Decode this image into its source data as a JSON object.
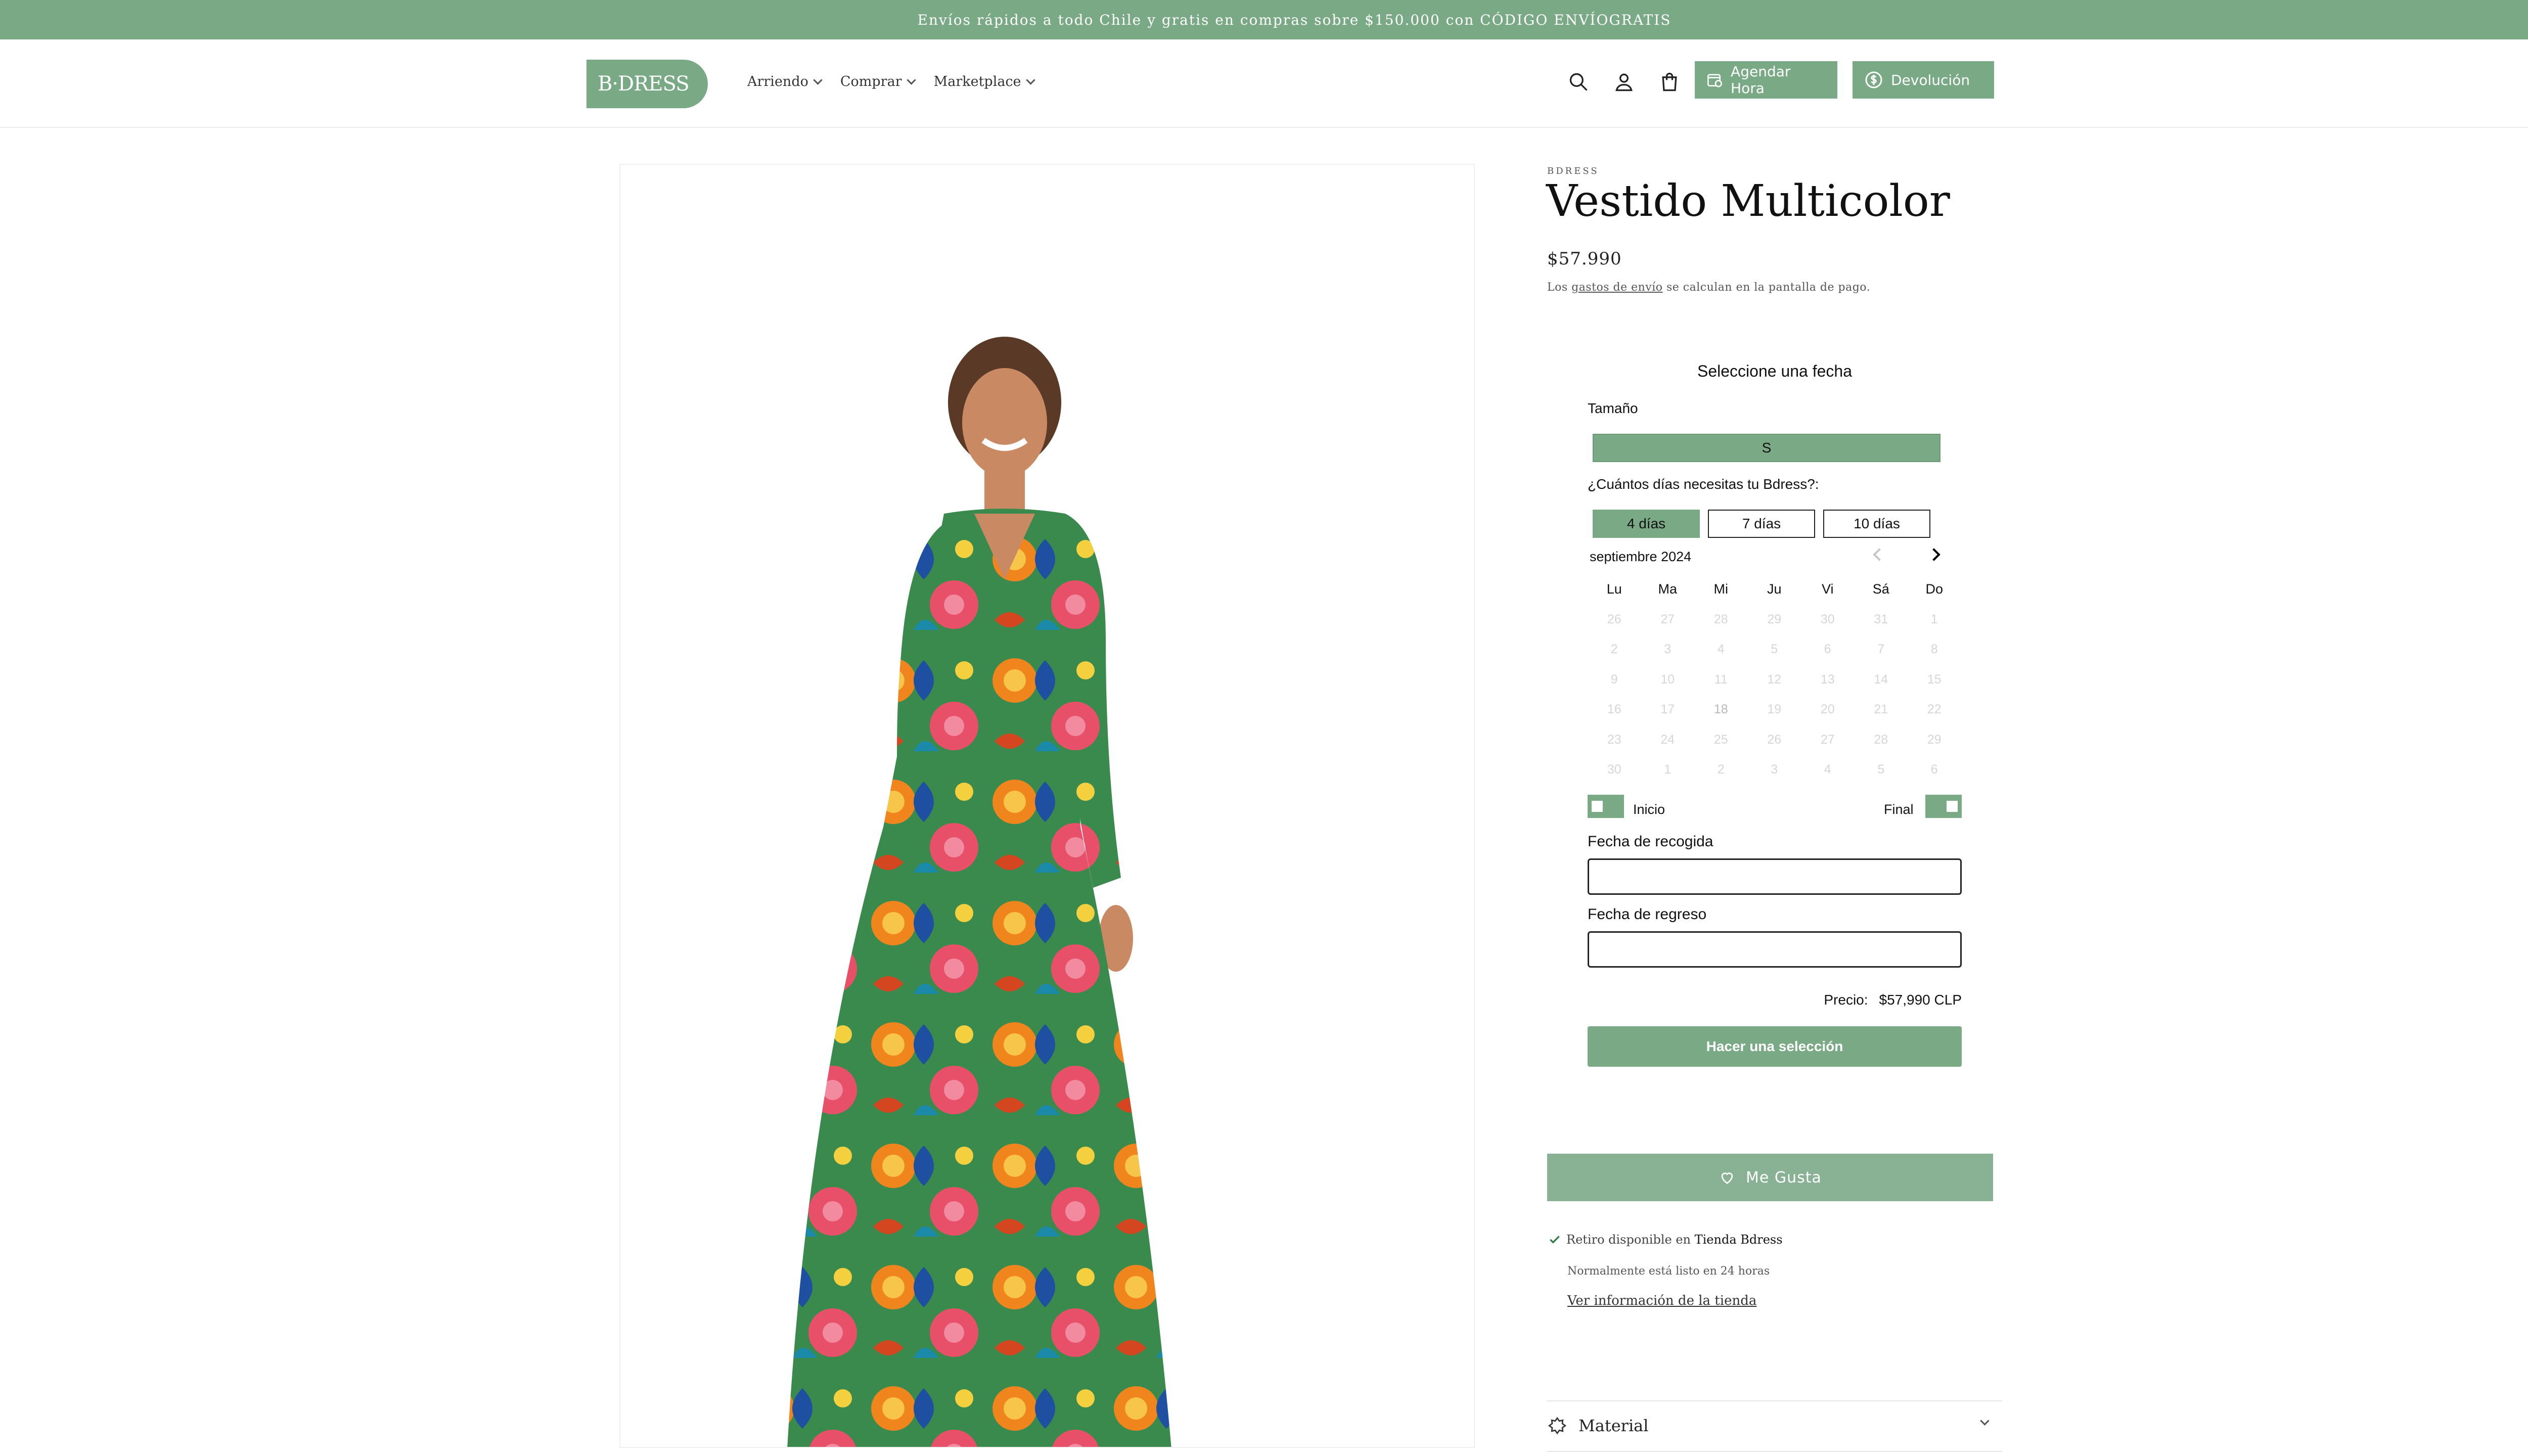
{
  "announcement": "Envíos rápidos a todo Chile y gratis en compras sobre $150.000 con CÓDIGO ENVÍOGRATIS",
  "header": {
    "logo_text": "B·DRESS",
    "nav": [
      {
        "label": "Arriendo"
      },
      {
        "label": "Comprar"
      },
      {
        "label": "Marketplace"
      }
    ],
    "icons": [
      "search-icon",
      "account-icon",
      "cart-icon"
    ],
    "buttons": {
      "schedule": "Agendar Hora",
      "returns": "Devolución"
    }
  },
  "product": {
    "vendor": "BDRESS",
    "title": "Vestido Multicolor",
    "price": "$57.990",
    "shipping_note_pre": "Los ",
    "shipping_link": "gastos de envío",
    "shipping_note_post": " se calculan en la pantalla de pago."
  },
  "rental": {
    "title": "Seleccione una fecha",
    "size_label": "Tamaño",
    "size_selected": "S",
    "days_label": "¿Cuántos días necesitas tu Bdress?:",
    "days_options": [
      {
        "label": "4 días",
        "active": true
      },
      {
        "label": "7 días",
        "active": false
      },
      {
        "label": "10 días",
        "active": false
      }
    ],
    "month": "septiembre 2024",
    "weekdays": [
      "Lu",
      "Ma",
      "Mi",
      "Ju",
      "Vi",
      "Sá",
      "Do"
    ],
    "weeks": [
      [
        "26",
        "27",
        "28",
        "29",
        "30",
        "31",
        "1"
      ],
      [
        "2",
        "3",
        "4",
        "5",
        "6",
        "7",
        "8"
      ],
      [
        "9",
        "10",
        "11",
        "12",
        "13",
        "14",
        "15"
      ],
      [
        "16",
        "17",
        "18",
        "19",
        "20",
        "21",
        "22"
      ],
      [
        "23",
        "24",
        "25",
        "26",
        "27",
        "28",
        "29"
      ],
      [
        "30",
        "1",
        "2",
        "3",
        "4",
        "5",
        "6"
      ]
    ],
    "toggle_start_label": "Inicio",
    "toggle_end_label": "Final",
    "pickup_label": "Fecha de recogida",
    "pickup_value": "",
    "return_label": "Fecha de regreso",
    "return_value": "",
    "price_label": "Precio:",
    "price_value": "$57,990 CLP",
    "submit_label": "Hacer una selección"
  },
  "like_label": "Me Gusta",
  "pickup": {
    "text_pre": "Retiro disponible en ",
    "store": "Tienda Bdress",
    "sub": "Normalmente está listo en 24 horas",
    "link": "Ver información de la tienda"
  },
  "accordion": {
    "material_label": "Material"
  },
  "colors": {
    "brand_green": "#7aa985",
    "like_green": "#88b293"
  }
}
